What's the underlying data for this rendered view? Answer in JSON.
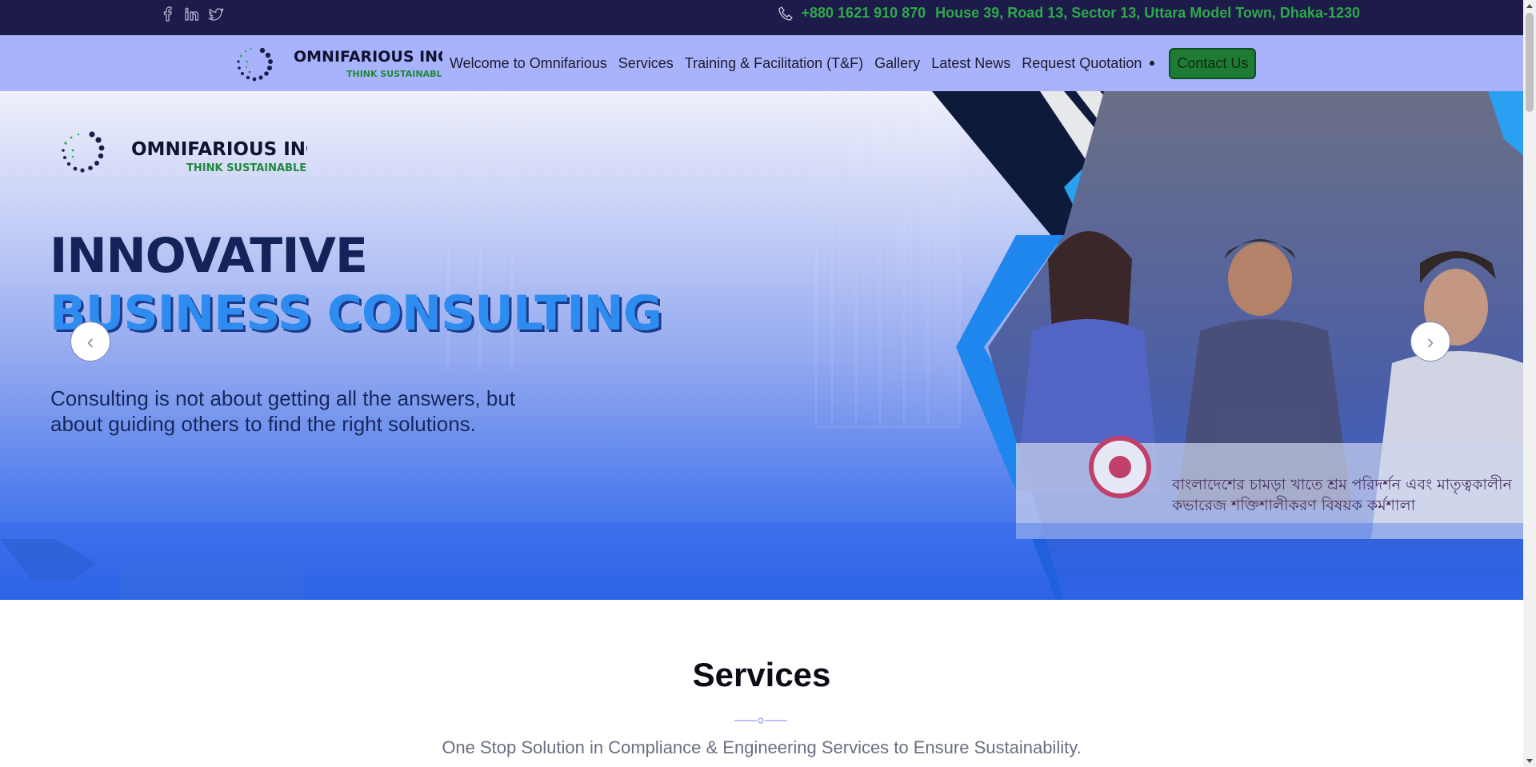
{
  "topbar": {
    "phone": "+880 1621 910 870",
    "address": "House 39, Road 13, Sector 13, Uttara Model Town, Dhaka-1230",
    "social_icons": [
      "facebook-icon",
      "linkedin-icon",
      "twitter-icon"
    ],
    "accent_color": "#2ea84a"
  },
  "nav": {
    "logo_name": "OMNIFARIOUS INC.",
    "logo_tagline": "THINK SUSTAINABLE",
    "items": [
      "Welcome to Omnifarious",
      "Services",
      "Training & Facilitation (T&F)",
      "Gallery",
      "Latest News",
      "Request Quotation"
    ],
    "contact_button": "Contact Us"
  },
  "hero": {
    "logo_name": "OMNIFARIOUS INC.",
    "logo_tagline": "THINK SUSTAINABLE",
    "title_line1": "INNOVATIVE",
    "title_line2": "BUSINESS CONSULTING",
    "text": "Consulting is not about getting all the answers, but about guiding others to find the right solutions.",
    "banner_line1": "বাংলাদেশের চামড়া খাতে শ্রম পরিদর্শন এবং মাতৃত্বকালীন",
    "banner_line2": "কভারেজ শক্তিশালীকরণ বিষয়ক কর্মশালা",
    "prev_label": "‹",
    "next_label": "›"
  },
  "services": {
    "title": "Services",
    "subtitle": "One Stop Solution in Compliance & Engineering Services to Ensure Sustainability."
  }
}
